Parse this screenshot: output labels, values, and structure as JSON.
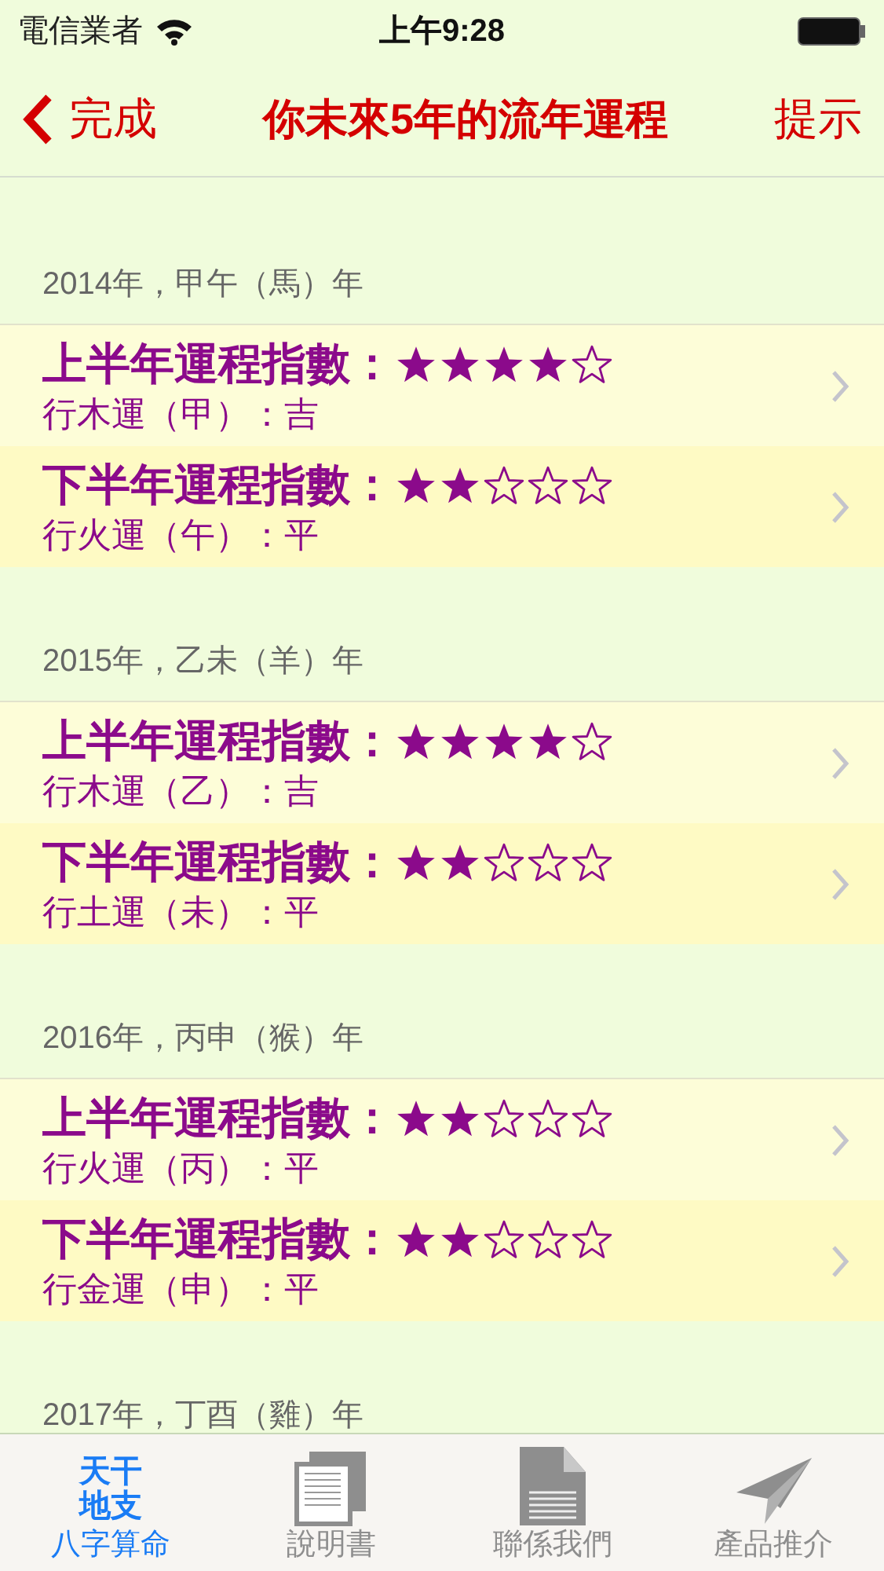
{
  "status_bar": {
    "carrier": "電信業者",
    "time": "上午9:28"
  },
  "nav": {
    "back": "完成",
    "title": "你未來5年的流年運程",
    "action": "提示"
  },
  "sections": [
    {
      "header": "2014年，甲午（馬）年",
      "rows": [
        {
          "title": "上半年運程指數：",
          "stars": 4,
          "detail": "行木運（甲）：吉"
        },
        {
          "title": "下半年運程指數：",
          "stars": 2,
          "detail": "行火運（午）：平"
        }
      ]
    },
    {
      "header": "2015年，乙未（羊）年",
      "rows": [
        {
          "title": "上半年運程指數：",
          "stars": 4,
          "detail": "行木運（乙）：吉"
        },
        {
          "title": "下半年運程指數：",
          "stars": 2,
          "detail": "行土運（未）：平"
        }
      ]
    },
    {
      "header": "2016年，丙申（猴）年",
      "rows": [
        {
          "title": "上半年運程指數：",
          "stars": 2,
          "detail": "行火運（丙）：平"
        },
        {
          "title": "下半年運程指數：",
          "stars": 2,
          "detail": "行金運（申）：平"
        }
      ]
    },
    {
      "header": "2017年，丁酉（雞）年"
    }
  ],
  "tabs": [
    {
      "label": "八字算命",
      "kind": "text",
      "icon_text": "天干地支",
      "selected": true
    },
    {
      "label": "說明書",
      "kind": "manual",
      "selected": false
    },
    {
      "label": "聯係我們",
      "kind": "document",
      "selected": false
    },
    {
      "label": "產品推介",
      "kind": "plane",
      "selected": false
    }
  ]
}
